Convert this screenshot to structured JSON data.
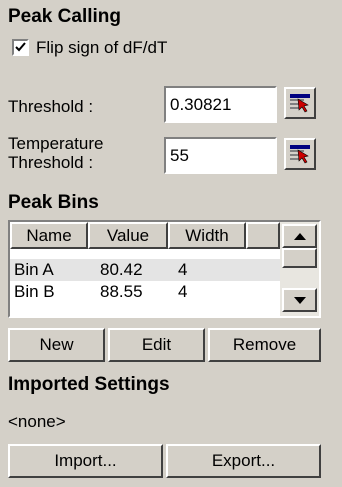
{
  "peak_calling": {
    "heading": "Peak Calling",
    "flip_sign_label": "Flip sign of dF/dT",
    "flip_sign_checked": true,
    "threshold_label": "Threshold :",
    "threshold_value": "0.30821",
    "temp_threshold_label_line1": "Temperature",
    "temp_threshold_label_line2": "Threshold :",
    "temp_threshold_value": "55",
    "icons": {
      "threshold_button": "cursor-pick-icon",
      "temp_threshold_button": "cursor-pick-icon"
    }
  },
  "peak_bins": {
    "heading": "Peak Bins",
    "columns": [
      "Name",
      "Value",
      "Width"
    ],
    "rows": [
      {
        "name": "Bin A",
        "value": "80.42",
        "width": "4"
      },
      {
        "name": "Bin B",
        "value": "88.55",
        "width": "4"
      }
    ],
    "buttons": {
      "new": "New",
      "edit": "Edit",
      "remove": "Remove"
    }
  },
  "imported_settings": {
    "heading": "Imported Settings",
    "value": "<none>",
    "buttons": {
      "import": "Import...",
      "export": "Export..."
    }
  },
  "colors": {
    "background": "#d4d0c8",
    "pick_icon_red": "#cc0000",
    "pick_icon_blue": "#000080"
  }
}
